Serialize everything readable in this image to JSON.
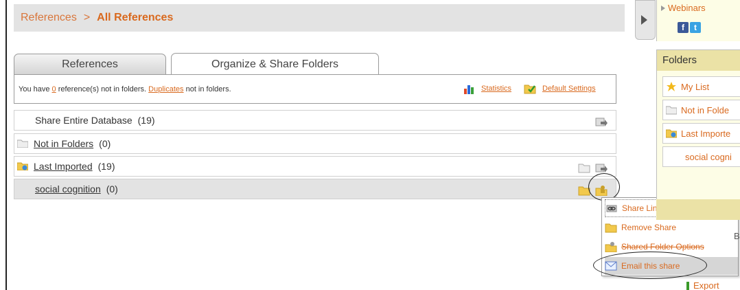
{
  "breadcrumb": {
    "root": "References",
    "separator": ">",
    "current": "All References"
  },
  "tabs": [
    {
      "label": "References",
      "active": false
    },
    {
      "label": "Organize & Share Folders",
      "active": true
    }
  ],
  "info": {
    "prefix": "You have ",
    "count": "0",
    "middle": " reference(s) not in folders. ",
    "duplicates": "Duplicates",
    "suffix": " not in folders.",
    "statistics": "Statistics",
    "default_settings": "Default Settings"
  },
  "rows": [
    {
      "label": "Share Entire Database",
      "count": "(19)"
    },
    {
      "label": "Not in Folders",
      "count": "(0)"
    },
    {
      "label": "Last Imported",
      "count": "(19)"
    },
    {
      "label": "social cognition",
      "count": "(0)"
    }
  ],
  "menu": {
    "items": [
      {
        "label": "Share Link",
        "icon": "chain-link-icon"
      },
      {
        "label": "Remove Share",
        "icon": "folder-icon"
      },
      {
        "label": "Shared Folder Options",
        "icon": "shared-folder-icon"
      },
      {
        "label": "Email this share",
        "icon": "envelope-icon"
      }
    ]
  },
  "right_panel": {
    "webinars": "Webinars",
    "folders_title": "Folders",
    "folders": [
      "My List",
      "Not in Folde",
      "Last Importe",
      "social cogni"
    ],
    "partial_letter": "B",
    "export": "Export"
  },
  "colors": {
    "accent": "#d9691e",
    "bar_grey": "#e3e3e3",
    "panel_yellow": "#fdfde6",
    "panel_header": "#ebe2a6"
  }
}
